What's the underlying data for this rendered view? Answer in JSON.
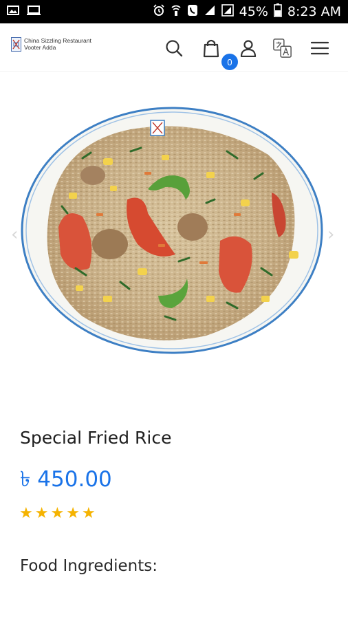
{
  "status_bar": {
    "battery_percent": "45%",
    "time": "8:23 AM",
    "icons": [
      "gallery-icon",
      "laptop-icon",
      "alarm-icon",
      "wifi-call-icon",
      "phone-icon",
      "signal-icon",
      "signal-box-icon",
      "battery-icon"
    ]
  },
  "header": {
    "logo_line1": "China Sizzling Restaurant",
    "logo_line2": "Vooter Adda",
    "cart_count": "0",
    "icons": [
      "search-icon",
      "cart-icon",
      "user-icon",
      "translate-icon",
      "menu-icon"
    ]
  },
  "carousel": {
    "prev_symbol": "‹",
    "next_symbol": "›"
  },
  "product": {
    "title": "Special Fried Rice",
    "price": "৳ 450.00",
    "rating_stars": 5,
    "star_symbol": "★",
    "ingredients_label": "Food Ingredients:"
  },
  "colors": {
    "accent": "#1a73e8",
    "star": "#f5b301",
    "status_bar": "#000000"
  }
}
